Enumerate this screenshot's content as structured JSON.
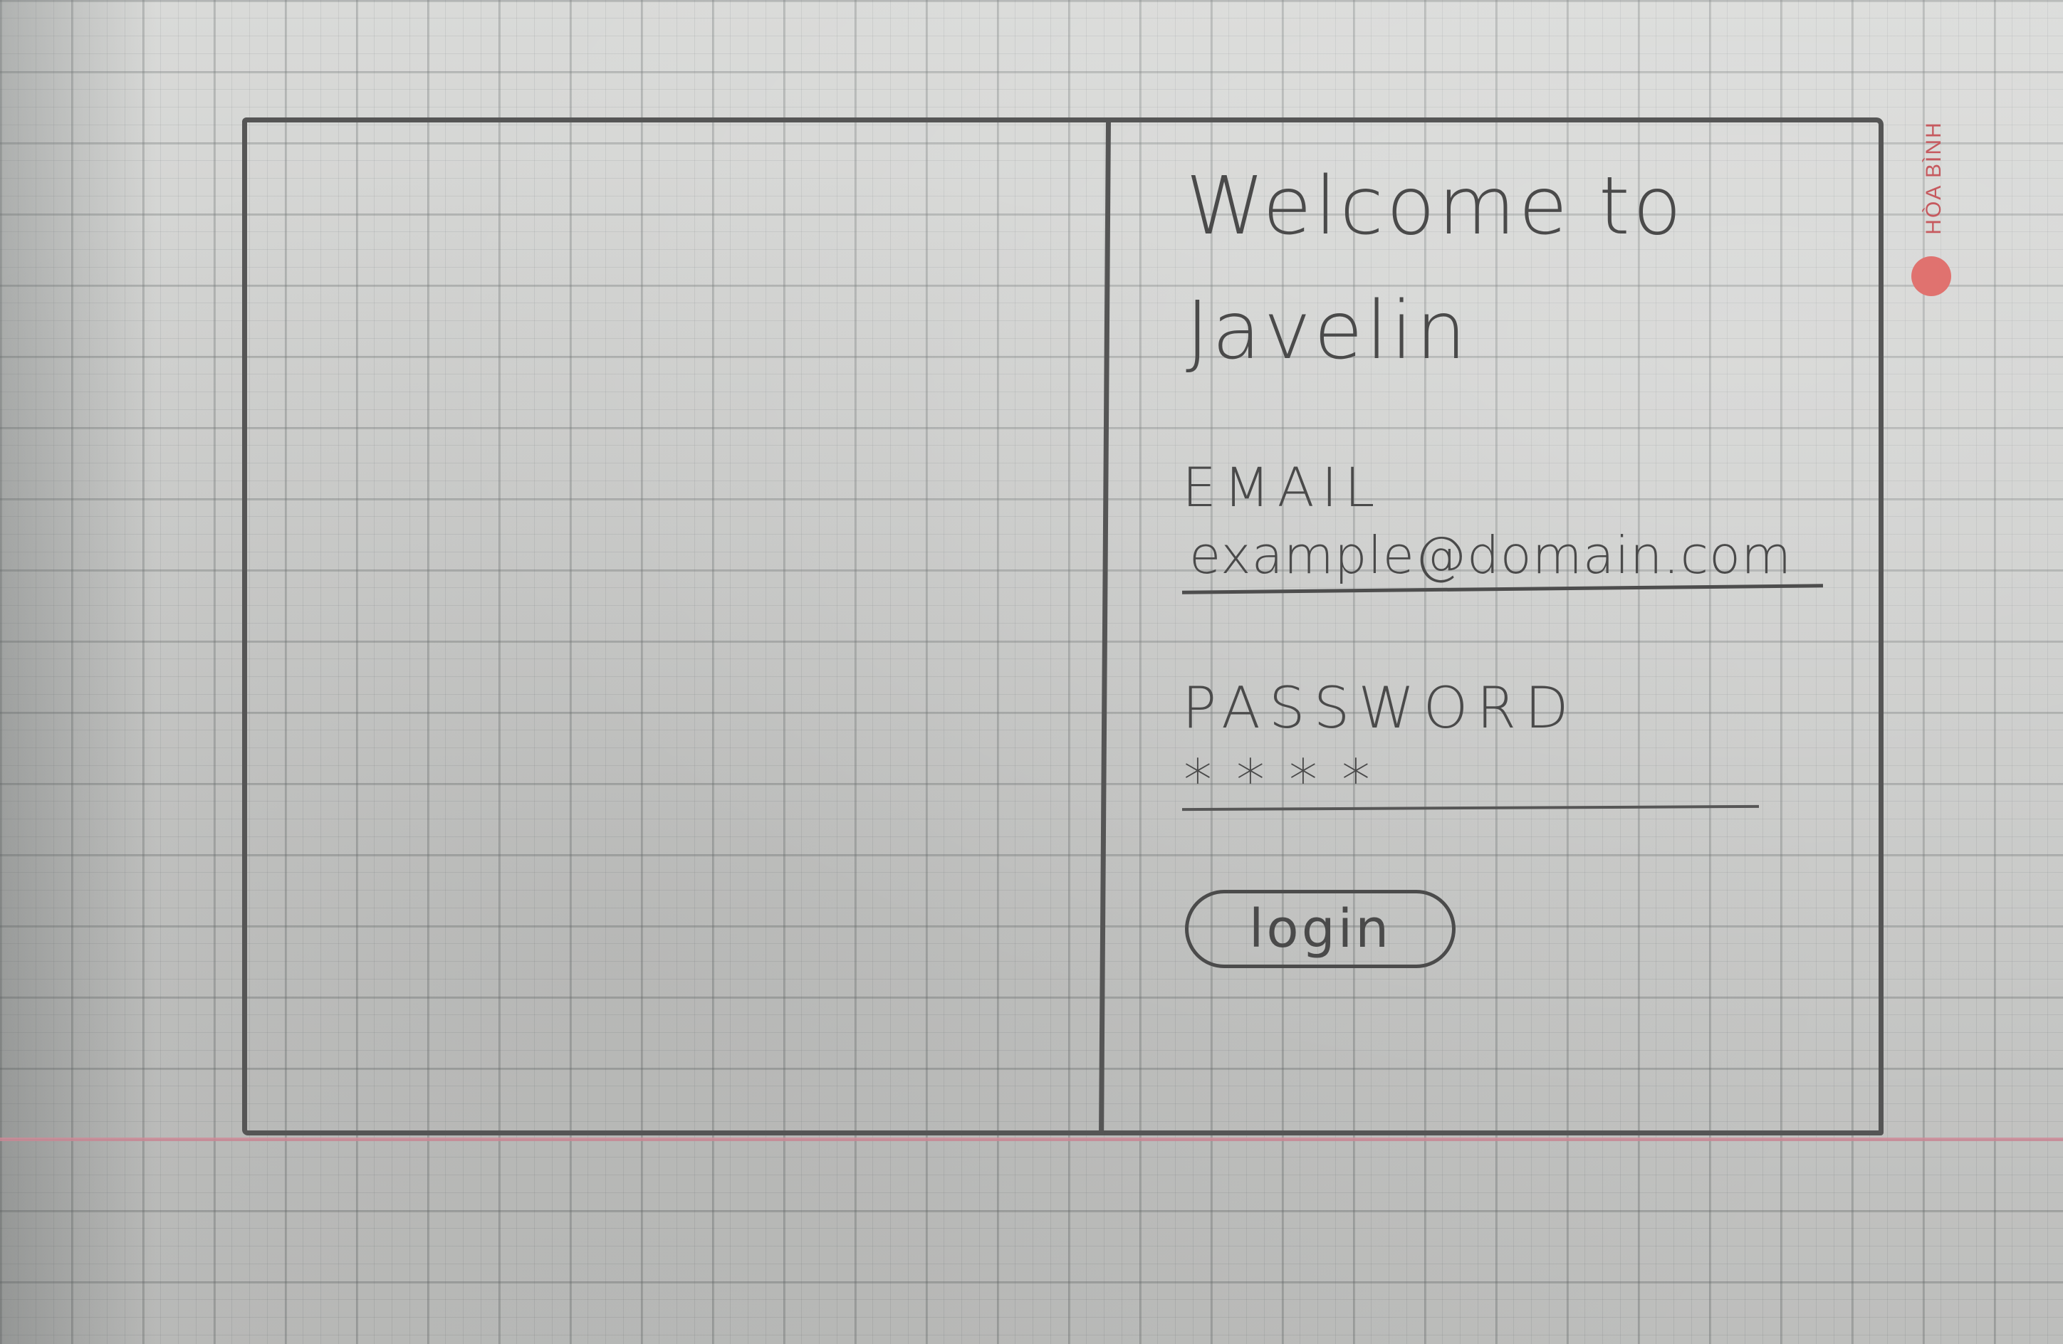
{
  "brand_stamp": "HÒA BÌNH",
  "login_panel": {
    "welcome_line1": "Welcome to",
    "welcome_line2": "Javelin",
    "email_label": "EMAIL",
    "email_value": "example@domain.com",
    "password_label": "PASSWORD",
    "password_value": "****",
    "login_label": "login"
  },
  "colors": {
    "pencil": "#4a4a4a",
    "grid_paper": "#d7d8d6",
    "margin_line": "#d08a97",
    "brand_red": "#e0726f"
  }
}
